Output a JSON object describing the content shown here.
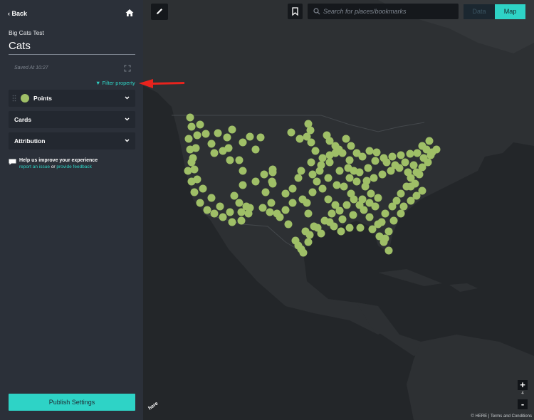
{
  "sidebar": {
    "back_label": "Back",
    "project_subtitle": "Big Cats Test",
    "project_title": "Cats",
    "saved_text": "Saved At 10:27",
    "filter_label": "Filter property",
    "panels": [
      {
        "label": "Points"
      },
      {
        "label": "Cards"
      },
      {
        "label": "Attribution"
      }
    ],
    "points_color": "#9fbf67",
    "help_title": "Help us improve your experience",
    "help_link_issue": "report an issue",
    "help_or": "or",
    "help_link_feedback": "provide feedback",
    "publish_label": "Publish Settings"
  },
  "map": {
    "search_placeholder": "Search for places/bookmarks",
    "tab_data": "Data",
    "tab_map": "Map",
    "zoom_in": "+",
    "zoom_out": "-",
    "zoom_level": "4",
    "logo": "here",
    "credit": "© HERE | Terms and Conditions"
  },
  "colors": {
    "accent": "#2ed3c6",
    "point": "#9fbf67",
    "annotation_arrow": "#e8231d"
  }
}
